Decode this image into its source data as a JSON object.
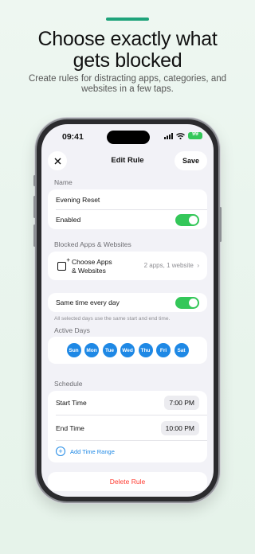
{
  "promo": {
    "headline_line1": "Choose exactly what",
    "headline_line2": "gets blocked",
    "subline": "Create rules for distracting apps, categories, and websites in a few taps.",
    "accent_color": "#1ea37a"
  },
  "status": {
    "time": "09:41",
    "battery": "99"
  },
  "nav": {
    "title": "Edit Rule",
    "save_label": "Save",
    "close_icon": "close-icon"
  },
  "name_section": {
    "label": "Name",
    "rule_name": "Evening Reset",
    "enabled_label": "Enabled",
    "enabled": true
  },
  "blocked_section": {
    "label": "Blocked Apps & Websites",
    "choose_label_line1": "Choose Apps",
    "choose_label_line2": "& Websites",
    "summary": "2 apps, 1 website"
  },
  "schedule_mode": {
    "same_time_label": "Same time every day",
    "same_time_enabled": true,
    "note": "All selected days use the same start and end time."
  },
  "active_days": {
    "label": "Active Days",
    "days": [
      "Sun",
      "Mon",
      "Tue",
      "Wed",
      "Thu",
      "Fri",
      "Sat"
    ],
    "day_color": "#1e88e5"
  },
  "schedule": {
    "label": "Schedule",
    "start_label": "Start Time",
    "start_value": "7:00 PM",
    "end_label": "End Time",
    "end_value": "10:00 PM",
    "add_range_label": "Add Time Range"
  },
  "delete_label": "Delete Rule"
}
